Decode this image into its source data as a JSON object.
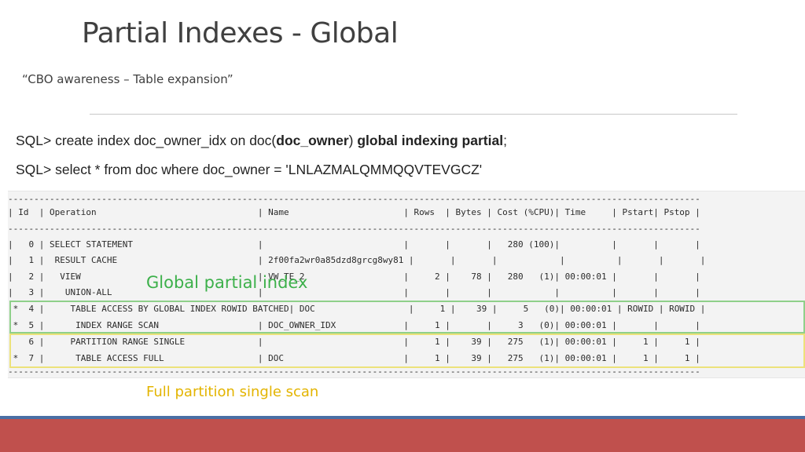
{
  "slide": {
    "title": "Partial Indexes - Global",
    "subtitle": "“CBO awareness – Table expansion”"
  },
  "sql": {
    "line1_prefix": "SQL> create index doc_owner_idx on doc(",
    "line1_bold_column": "doc_owner",
    "line1_close": ") ",
    "line1_bold_clause": "global indexing partial",
    "line1_suffix": ";",
    "line2": "SQL> select * from doc where doc_owner = 'LNLAZMALQMMQQVTEVGCZ'"
  },
  "plan": {
    "lines": [
      "-------------------------------------------------------------------------------------------------------------------------------------",
      "| Id  | Operation                               | Name                      | Rows  | Bytes | Cost (%CPU)| Time     | Pstart| Pstop |",
      "-------------------------------------------------------------------------------------------------------------------------------------",
      "|   0 | SELECT STATEMENT                        |                           |       |       |   280 (100)|          |       |       |",
      "|   1 |  RESULT CACHE                           | 2f00fa2wr0a85dzd8grcg8wy81 |       |       |            |          |       |       |",
      "|   2 |   VIEW                                  | VW_TE_2                   |     2 |    78 |   280   (1)| 00:00:01 |       |       |",
      "|   3 |    UNION-ALL                            |                           |       |       |            |          |       |       |",
      "|*  4 |     TABLE ACCESS BY GLOBAL INDEX ROWID BATCHED| DOC                  |     1 |    39 |     5   (0)| 00:00:01 | ROWID | ROWID |",
      "|*  5 |      INDEX RANGE SCAN                   | DOC_OWNER_IDX             |     1 |       |     3   (0)| 00:00:01 |       |       |",
      "|   6 |     PARTITION RANGE SINGLE              |                           |     1 |    39 |   275   (1)| 00:00:01 |     1 |     1 |",
      "|*  7 |      TABLE ACCESS FULL                  | DOC                       |     1 |    39 |   275   (1)| 00:00:01 |     1 |     1 |",
      "-------------------------------------------------------------------------------------------------------------------------------------"
    ]
  },
  "annotations": {
    "global_partial_index": "Global partial index",
    "full_partition_single_scan": "Full partition single scan"
  },
  "colors": {
    "green_highlight": "#8fd08a",
    "yellow_highlight": "#ece27a",
    "footer_blue": "#4a6fa5",
    "footer_red": "#c0504d"
  }
}
